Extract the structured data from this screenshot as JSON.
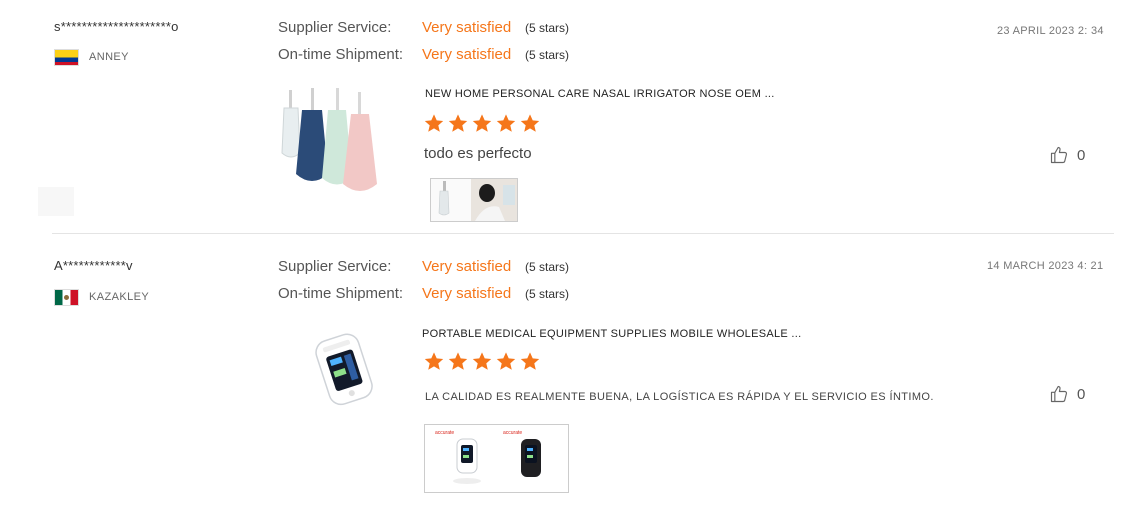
{
  "reviews": [
    {
      "user": "s*********************o",
      "country": "ANNEY",
      "flag": "colombia-flag-icon",
      "supplier_label": "Supplier Service:",
      "supplier_value": "Very satisfied",
      "supplier_stars": "(5 stars)",
      "shipment_label": "On-time Shipment:",
      "shipment_value": "Very satisfied",
      "shipment_stars": "(5 stars)",
      "date": "23 APRIL 2023 2: 34",
      "product_title": "NEW HOME PERSONAL CARE NASAL IRRIGATOR NOSE OEM ...",
      "rating": 5,
      "text": "todo es perfecto",
      "likes": "0"
    },
    {
      "user": "A************v",
      "country": "KAZAKLEY",
      "flag": "mexico-flag-icon",
      "supplier_label": "Supplier Service:",
      "supplier_value": "Very satisfied",
      "supplier_stars": "(5 stars)",
      "shipment_label": "On-time Shipment:",
      "shipment_value": "Very satisfied",
      "shipment_stars": "(5 stars)",
      "date": "14 MARCH 2023 4: 21",
      "product_title": "PORTABLE MEDICAL EQUIPMENT SUPPLIES MOBILE WHOLESALE ...",
      "rating": 5,
      "text": "LA CALIDAD ES REALMENTE BUENA, LA LOGÍSTICA ES RÁPIDA Y EL SERVICIO ES ÍNTIMO.",
      "likes": "0",
      "thumb_brand": "accurate"
    }
  ],
  "colors": {
    "accent": "#f5761a",
    "star": "#f5761a"
  }
}
